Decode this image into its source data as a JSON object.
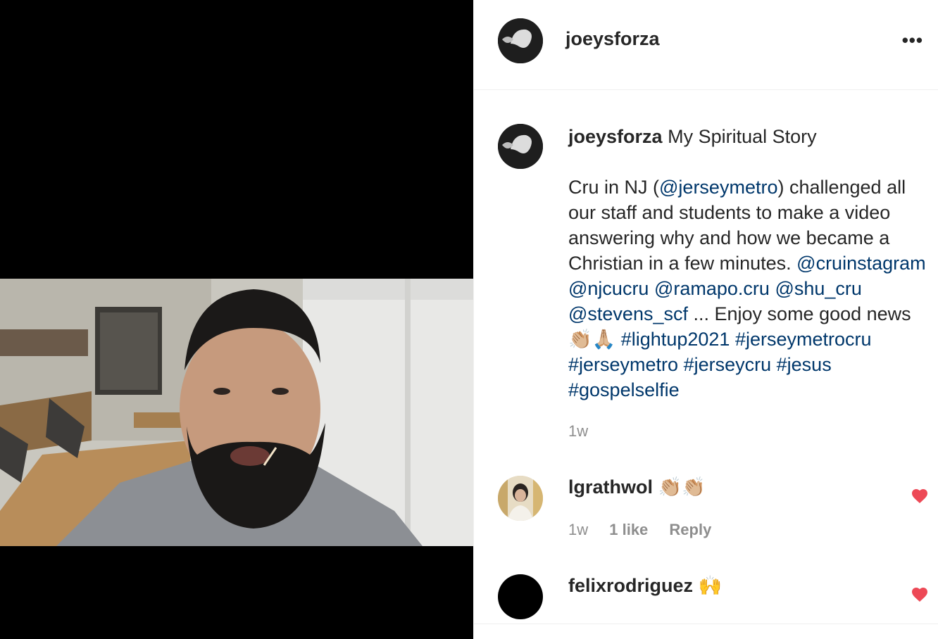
{
  "post": {
    "username": "joeysforza",
    "more_icon": "more-horizontal-icon",
    "more_label": "•••"
  },
  "caption": {
    "username": "joeysforza",
    "title": "My Spiritual Story",
    "intro": "Cru in NJ (",
    "mention_jerseymetro": "@jerseymetro",
    "body_1": ") challenged all our staff and students to make a video answering why and how we became a Christian in a few minutes.",
    "mention_cruinstagram": "@cruinstagram",
    "mention_njcucru": "@njcucru",
    "mention_ramapo": "@ramapo.cru",
    "mention_shu": "@shu_cru",
    "mention_stevens": "@stevens_scf",
    "body_2": "... Enjoy some good news",
    "emoji": "👏🏼🙏🏼",
    "tag_lightup": "#lightup2021",
    "tag_jerseymetrocru": "#jerseymetrocru",
    "tag_jerseymetro": "#jerseymetro",
    "tag_jerseycru": "#jerseycru",
    "tag_jesus": "#jesus",
    "tag_gospelselfie": "#gospelselfie",
    "time": "1w"
  },
  "comments": [
    {
      "username": "lgrathwol",
      "text": "👏🏼👏🏼",
      "time": "1w",
      "likes": "1 like",
      "reply": "Reply",
      "heart_color": "#ed4956"
    },
    {
      "username": "felixrodriguez",
      "text": "🙌",
      "heart_color": "#ed4956"
    }
  ]
}
